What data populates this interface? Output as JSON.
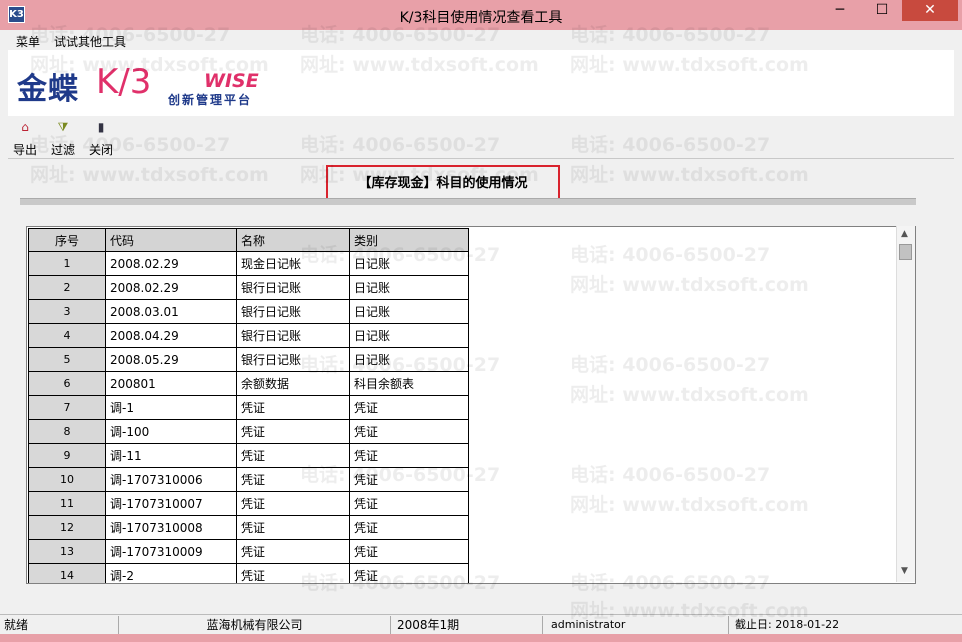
{
  "window": {
    "title": "K/3科目使用情况查看工具",
    "app_icon": "K3",
    "minimize": "─",
    "maximize": "☐",
    "close": "✕"
  },
  "menu": [
    "菜单",
    "试试其他工具"
  ],
  "logo": {
    "brand_cn": "金蝶",
    "brand_k3": "K/3",
    "wise": "WISE",
    "slogan": "创新管理平台"
  },
  "toolbar": [
    {
      "label": "导出",
      "icon": "export-icon"
    },
    {
      "label": "过滤",
      "icon": "filter-icon"
    },
    {
      "label": "关闭",
      "icon": "close-door-icon"
    }
  ],
  "report": {
    "title": "【库存现金】科目的使用情况"
  },
  "table": {
    "columns": [
      "序号",
      "代码",
      "名称",
      "类别"
    ],
    "rows": [
      [
        "1",
        "2008.02.29",
        "现金日记帐",
        "日记账"
      ],
      [
        "2",
        "2008.02.29",
        "银行日记账",
        "日记账"
      ],
      [
        "3",
        "2008.03.01",
        "银行日记账",
        "日记账"
      ],
      [
        "4",
        "2008.04.29",
        "银行日记账",
        "日记账"
      ],
      [
        "5",
        "2008.05.29",
        "银行日记账",
        "日记账"
      ],
      [
        "6",
        "200801",
        "余额数据",
        "科目余额表"
      ],
      [
        "7",
        "调-1",
        "凭证",
        "凭证"
      ],
      [
        "8",
        "调-100",
        "凭证",
        "凭证"
      ],
      [
        "9",
        "调-11",
        "凭证",
        "凭证"
      ],
      [
        "10",
        "调-1707310006",
        "凭证",
        "凭证"
      ],
      [
        "11",
        "调-1707310007",
        "凭证",
        "凭证"
      ],
      [
        "12",
        "调-1707310008",
        "凭证",
        "凭证"
      ],
      [
        "13",
        "调-1707310009",
        "凭证",
        "凭证"
      ],
      [
        "14",
        "调-2",
        "凭证",
        "凭证"
      ]
    ]
  },
  "status": {
    "state": "就绪",
    "company": "蓝海机械有限公司",
    "period": "2008年1期",
    "user": "administrator",
    "deadline": "截止日: 2018-01-22"
  },
  "watermark": {
    "phone": "电话: 4006-6500-27",
    "site": "网址: www.tdxsoft.com"
  },
  "colors": {
    "title_bar": "#e8a0a8",
    "close_button": "#c84a3e",
    "highlight_box": "#d9232e",
    "brand_blue": "#1f3a8a",
    "brand_pink": "#e0306a"
  }
}
